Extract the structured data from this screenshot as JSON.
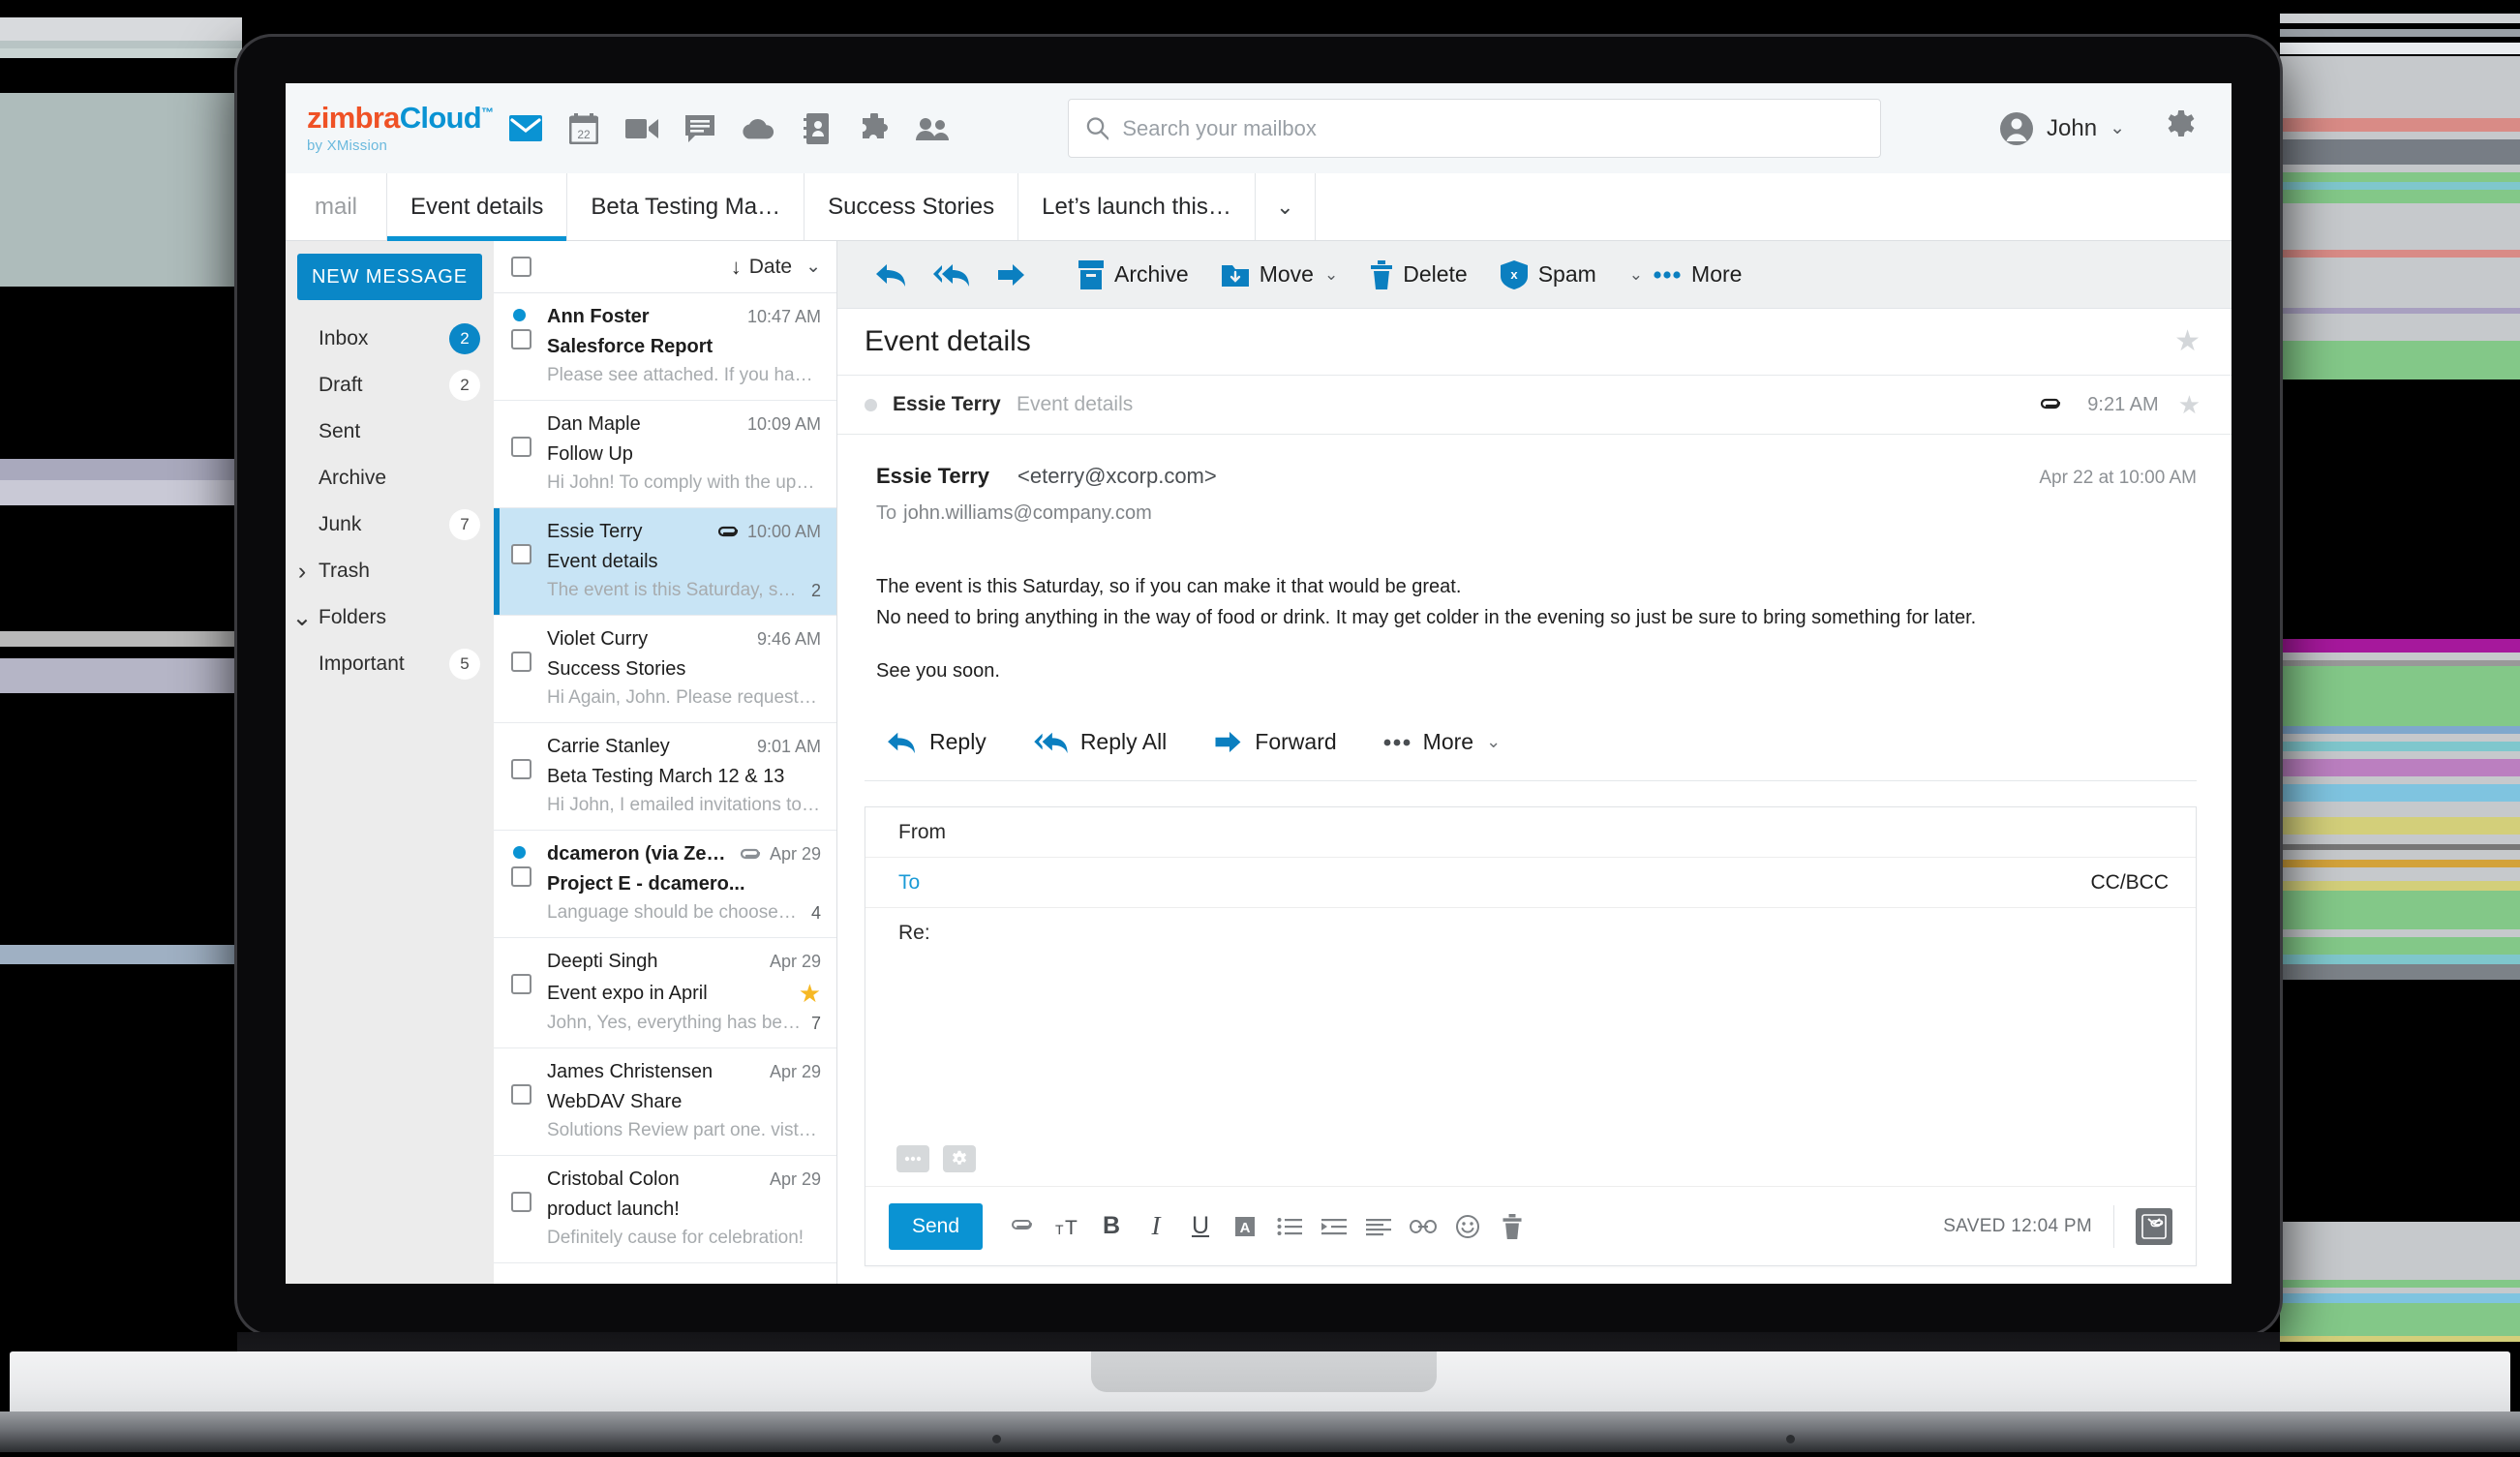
{
  "brand": {
    "name_part1": "zimbra",
    "name_part2": "Cloud",
    "tm": "™",
    "tagline": "by XMission"
  },
  "top_nav_icons": [
    "mail-icon",
    "calendar-icon",
    "video-icon",
    "chat-icon",
    "cloud-icon",
    "contacts-card-icon",
    "puzzle-icon",
    "people-icon"
  ],
  "search": {
    "placeholder": "Search your mailbox",
    "value": ""
  },
  "account": {
    "name": "John",
    "caret": "⌄"
  },
  "tabs": {
    "app_label": "mail",
    "items": [
      {
        "label": "Event details",
        "active": true
      },
      {
        "label": "Beta Testing Ma…",
        "active": false
      },
      {
        "label": "Success Stories",
        "active": false
      },
      {
        "label": "Let’s launch this…",
        "active": false
      }
    ],
    "overflow_caret": "⌄"
  },
  "sidebar": {
    "new_message": "NEW MESSAGE",
    "items": [
      {
        "label": "Inbox",
        "badge": "2",
        "accent": true,
        "caret": ""
      },
      {
        "label": "Draft",
        "badge": "2",
        "accent": false,
        "caret": ""
      },
      {
        "label": "Sent",
        "badge": "",
        "accent": false,
        "caret": ""
      },
      {
        "label": "Archive",
        "badge": "",
        "accent": false,
        "caret": ""
      },
      {
        "label": "Junk",
        "badge": "7",
        "accent": false,
        "caret": ""
      },
      {
        "label": "Trash",
        "badge": "",
        "accent": false,
        "caret": "›"
      },
      {
        "label": "Folders",
        "badge": "",
        "accent": false,
        "caret": "⌄"
      },
      {
        "label": "Important",
        "badge": "5",
        "accent": false,
        "caret": ""
      }
    ]
  },
  "message_list": {
    "sort_label": "Date",
    "sort_arrow": "↓",
    "sort_caret": "⌄",
    "messages": [
      {
        "sender": "Ann Foster",
        "subject": "Salesforce Report",
        "preview": "Please see attached. If you have any",
        "time": "10:47 AM",
        "unread": true,
        "attachment": false,
        "count": "",
        "starred": false,
        "selected": false
      },
      {
        "sender": "Dan Maple",
        "subject": "Follow Up",
        "preview": "Hi John! To comply with the upcoming",
        "time": "10:09 AM",
        "unread": false,
        "attachment": false,
        "count": "",
        "starred": false,
        "selected": false
      },
      {
        "sender": "Essie Terry",
        "subject": "Event details",
        "preview": "The event is this Saturday, so if you can",
        "time": "10:00 AM",
        "unread": false,
        "attachment": true,
        "count": "2",
        "starred": false,
        "selected": true
      },
      {
        "sender": "Violet Curry",
        "subject": "Success Stories",
        "preview": "Hi Again, John. Please request success",
        "time": "9:46 AM",
        "unread": false,
        "attachment": false,
        "count": "",
        "starred": false,
        "selected": false
      },
      {
        "sender": "Carrie Stanley",
        "subject": "Beta Testing March 12 & 13",
        "preview": "Hi John, I emailed invitations to everyone",
        "time": "9:01 AM",
        "unread": false,
        "attachment": false,
        "count": "",
        "starred": false,
        "selected": false
      },
      {
        "sender": "dcameron (via Zeplin)",
        "subject": "Project E - dcamero...",
        "preview": "Language should be choosen using a",
        "time": "Apr 29",
        "unread": true,
        "attachment": true,
        "count": "4",
        "starred": false,
        "selected": false
      },
      {
        "sender": "Deepti Singh",
        "subject": "Event expo in April",
        "preview": "John, Yes, everything has been ordered.",
        "time": "Apr 29",
        "unread": false,
        "attachment": false,
        "count": "7",
        "starred": true,
        "selected": false
      },
      {
        "sender": "James Christensen",
        "subject": "WebDAV Share",
        "preview": "Solutions Review part one.   vist link for",
        "time": "Apr 29",
        "unread": false,
        "attachment": false,
        "count": "",
        "starred": false,
        "selected": false
      },
      {
        "sender": "Cristobal Colon",
        "subject": "product launch!",
        "preview": "Definitely cause for celebration!",
        "time": "Apr 29",
        "unread": false,
        "attachment": false,
        "count": "",
        "starred": false,
        "selected": false
      }
    ]
  },
  "reader_toolbar": {
    "reply_icon": "reply-icon",
    "reply_all_icon": "reply-all-icon",
    "forward_icon": "forward-icon",
    "buttons": [
      {
        "label": "Archive",
        "icon": "archive-box-icon",
        "caret": ""
      },
      {
        "label": "Move",
        "icon": "move-folder-icon",
        "caret": "⌄"
      },
      {
        "label": "Delete",
        "icon": "trash-icon",
        "caret": ""
      },
      {
        "label": "Spam",
        "icon": "spam-shield-icon",
        "caret": ""
      },
      {
        "label": "More",
        "icon": "more-dots-icon",
        "caret": "⌄"
      }
    ]
  },
  "reader": {
    "subject": "Event details",
    "conversation_row": {
      "from": "Essie Terry",
      "subject": "Event details",
      "time": "9:21 AM",
      "attachment_icon": "paperclip-icon"
    },
    "message": {
      "from_name": "Essie Terry",
      "from_email": "<eterry@xcorp.com>",
      "date": "Apr 22 at 10:00 AM",
      "to_label": "To",
      "to_address": "john.williams@company.com",
      "body_line1": "The event is this Saturday, so if you can make it that would be great.",
      "body_line2": "No need to bring anything in the way of food or drink. It may get colder in the evening so just be sure to bring something for later.",
      "body_line3": "See you soon."
    },
    "actions": [
      {
        "label": "Reply",
        "icon": "reply-icon",
        "caret": ""
      },
      {
        "label": "Reply All",
        "icon": "reply-all-icon",
        "caret": ""
      },
      {
        "label": "Forward",
        "icon": "forward-icon",
        "caret": ""
      },
      {
        "label": "More",
        "icon": "more-dots-icon",
        "caret": "⌄"
      }
    ]
  },
  "compose": {
    "from_label": "From",
    "from_value": "",
    "to_label": "To",
    "to_value": "",
    "ccbcc_label": "CC/BCC",
    "subject_label": "Re:",
    "subject_value": "",
    "send_label": "Send",
    "saved_label": "SAVED 12:04 PM",
    "body_icons": [
      "more-dots-icon",
      "gear-icon"
    ],
    "format_icons": [
      "attachment-icon",
      "font-size-icon",
      "bold-icon",
      "italic-icon",
      "underline-icon",
      "text-color-icon",
      "bulleted-list-icon",
      "indent-icon",
      "align-icon",
      "link-icon",
      "emoji-icon",
      "trash-icon"
    ],
    "attach_icon": "attach-image-icon"
  },
  "colors": {
    "accent_blue": "#0a93d3",
    "brand_orange": "#ef5226",
    "selected_row": "#c8e4f5",
    "star_gold": "#f6b824"
  }
}
